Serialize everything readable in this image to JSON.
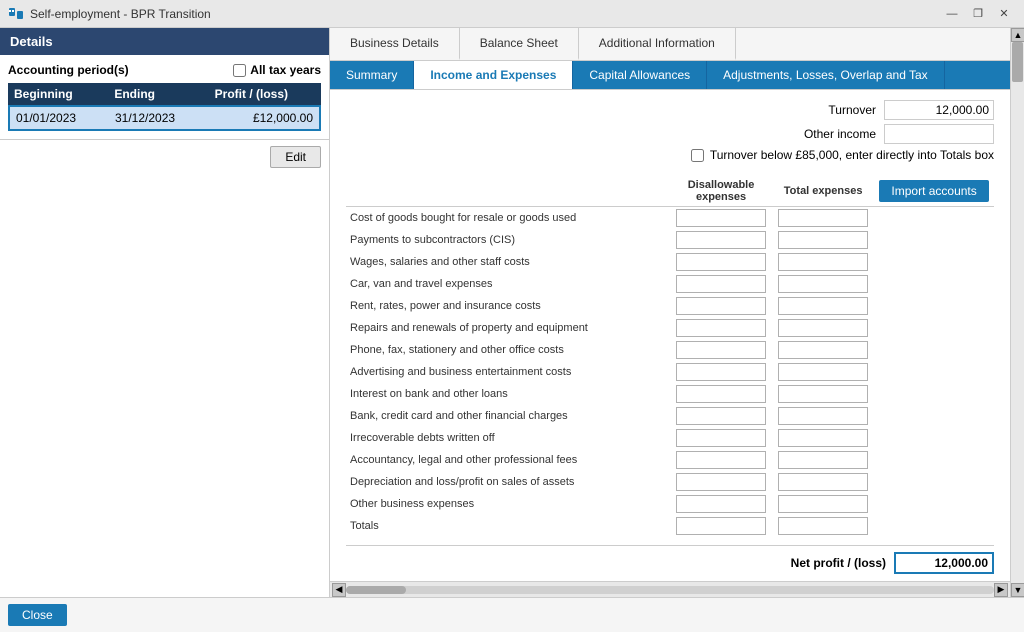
{
  "titleBar": {
    "title": "Self-employment - BPR Transition",
    "controls": {
      "minimize": "—",
      "restore": "❐",
      "close": "✕"
    }
  },
  "leftPanel": {
    "header": "Details",
    "accountingSection": {
      "title": "Accounting period(s)",
      "allTaxYears": "All tax years",
      "tableHeaders": {
        "beginning": "Beginning",
        "ending": "Ending",
        "profitLoss": "Profit / (loss)"
      },
      "tableRow": {
        "beginning": "01/01/2023",
        "ending": "31/12/2023",
        "profitLoss": "£12,000.00"
      },
      "editButton": "Edit"
    }
  },
  "rightPanel": {
    "topTabs": [
      {
        "id": "business-details",
        "label": "Business Details",
        "active": false
      },
      {
        "id": "balance-sheet",
        "label": "Balance Sheet",
        "active": false
      },
      {
        "id": "additional-information",
        "label": "Additional Information",
        "active": false
      }
    ],
    "subTabs": [
      {
        "id": "summary",
        "label": "Summary",
        "active": false
      },
      {
        "id": "income-expenses",
        "label": "Income and Expenses",
        "active": true
      },
      {
        "id": "capital-allowances",
        "label": "Capital Allowances",
        "active": false
      },
      {
        "id": "adjustments",
        "label": "Adjustments, Losses, Overlap and Tax",
        "active": false
      }
    ],
    "turnoverSection": {
      "turnoverLabel": "Turnover",
      "turnoverValue": "12,000.00",
      "otherIncomeLabel": "Other income",
      "otherIncomeValue": "",
      "below85kText": "Turnover below £85,000, enter directly into Totals box"
    },
    "expensesHeaders": {
      "disallowable": "Disallowable expenses",
      "total": "Total expenses"
    },
    "importButton": "Import accounts",
    "expenseRows": [
      {
        "label": "Cost of goods bought for resale or goods used"
      },
      {
        "label": "Payments to subcontractors (CIS)"
      },
      {
        "label": "Wages, salaries and other staff costs"
      },
      {
        "label": "Car, van and travel expenses"
      },
      {
        "label": "Rent, rates, power and insurance costs"
      },
      {
        "label": "Repairs and renewals of property and equipment"
      },
      {
        "label": "Phone, fax, stationery and other office costs"
      },
      {
        "label": "Advertising and business entertainment costs"
      },
      {
        "label": "Interest on bank and other loans"
      },
      {
        "label": "Bank, credit card and other financial charges"
      },
      {
        "label": "Irrecoverable debts written off"
      },
      {
        "label": "Accountancy, legal and other professional fees"
      },
      {
        "label": "Depreciation and loss/profit on sales of assets"
      },
      {
        "label": "Other business expenses"
      },
      {
        "label": "Totals"
      }
    ],
    "netProfit": {
      "label": "Net profit / (loss)",
      "value": "12,000.00"
    },
    "closeButton": "Close"
  }
}
